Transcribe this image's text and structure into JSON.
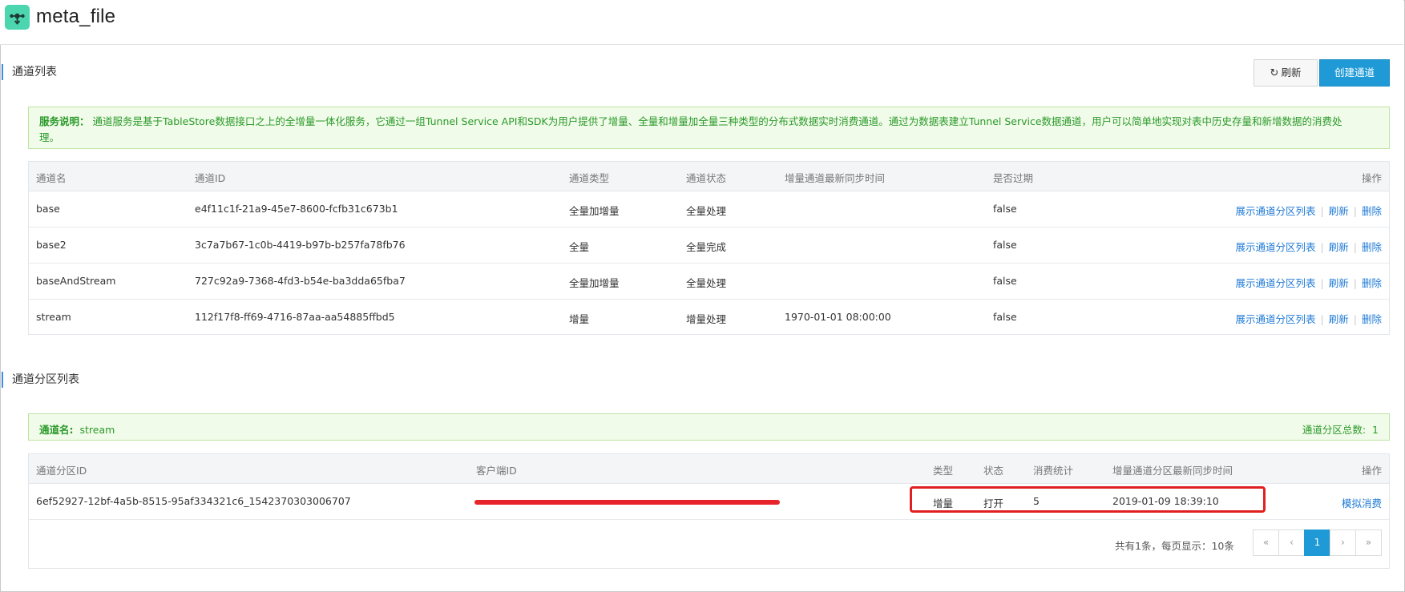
{
  "app": {
    "title": "meta_file",
    "logo_icon": "share-node-icon"
  },
  "tunnel_list": {
    "section_title": "通道列表",
    "refresh_label": "刷新",
    "create_label": "创建通道",
    "notice_label": "服务说明：",
    "notice_text_1": "通道服务是基于TableStore数据接口之上的全增量一体化服务，它通过一组Tunnel Service API和SDK为用户提供了增量、全量和增量加全量三种类型的分布式数据实时消费通道。通过为数据表建立Tunnel Service数据通道，用户可以简单地实现对表中历史存量和新增数据的消费处",
    "notice_text_2": "理。",
    "columns": [
      "通道名",
      "通道ID",
      "通道类型",
      "通道状态",
      "增量通道最新同步时间",
      "是否过期",
      "操作"
    ],
    "actions": {
      "show_partitions": "展示通道分区列表",
      "refresh": "刷新",
      "delete": "删除"
    },
    "rows": [
      {
        "name": "base",
        "id": "e4f11c1f-21a9-45e7-8600-fcfb31c673b1",
        "type": "全量加增量",
        "status": "全量处理",
        "sync_time": "",
        "expired": "false"
      },
      {
        "name": "base2",
        "id": "3c7a7b67-1c0b-4419-b97b-b257fa78fb76",
        "type": "全量",
        "status": "全量完成",
        "sync_time": "",
        "expired": "false"
      },
      {
        "name": "baseAndStream",
        "id": "727c92a9-7368-4fd3-b54e-ba3dda65fba7",
        "type": "全量加增量",
        "status": "全量处理",
        "sync_time": "",
        "expired": "false"
      },
      {
        "name": "stream",
        "id": "112f17f8-ff69-4716-87aa-aa54885ffbd5",
        "type": "增量",
        "status": "增量处理",
        "sync_time": "1970-01-01 08:00:00",
        "expired": "false"
      }
    ]
  },
  "partition_list": {
    "section_title": "通道分区列表",
    "tunnel_label": "通道名:",
    "tunnel_name": "stream",
    "total_label": "通道分区总数:",
    "total_value": "1",
    "columns": [
      "通道分区ID",
      "客户端ID",
      "类型",
      "状态",
      "消费统计",
      "增量通道分区最新同步时间",
      "操作"
    ],
    "rows": [
      {
        "partition_id": "6ef52927-12bf-4a5b-8515-95af334321c6_1542370303006707",
        "client_id": "",
        "type": "增量",
        "status": "打开",
        "consumed": "5",
        "sync_time": "2019-01-09 18:39:10",
        "action": "模拟消费"
      }
    ],
    "pager": {
      "summary": "共有1条，每页显示：10条",
      "first": "«",
      "prev": "‹",
      "current": "1",
      "next": "›",
      "last": "»"
    }
  },
  "colors": {
    "accent": "#1f9ad6",
    "link": "#1f7ad6",
    "notice_bg": "#f1fbe9",
    "notice_text": "#2a9a2a",
    "logo": "#4cd6b0",
    "highlight": "#e02020"
  }
}
